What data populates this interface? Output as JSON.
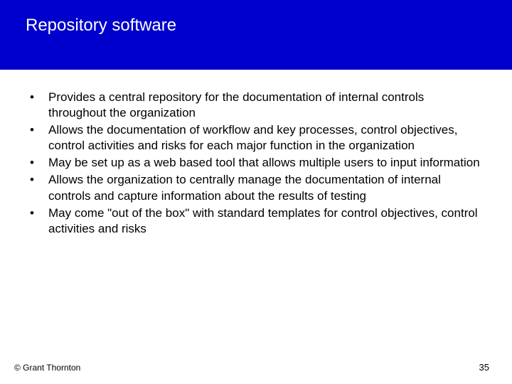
{
  "title": "Repository software",
  "bullets": [
    "Provides a central repository for the documentation of internal controls throughout the organization",
    "Allows the documentation of workflow and key processes, control objectives, control activities and risks for each major function in the organization",
    "May be set up as a web based tool that allows multiple users to input information",
    "Allows the organization to centrally manage the documentation of internal controls and capture information about the results of testing",
    "May come \"out of the box\" with standard templates for control objectives, control activities and risks"
  ],
  "footer": {
    "copyright": "© Grant Thornton",
    "page_number": "35"
  }
}
